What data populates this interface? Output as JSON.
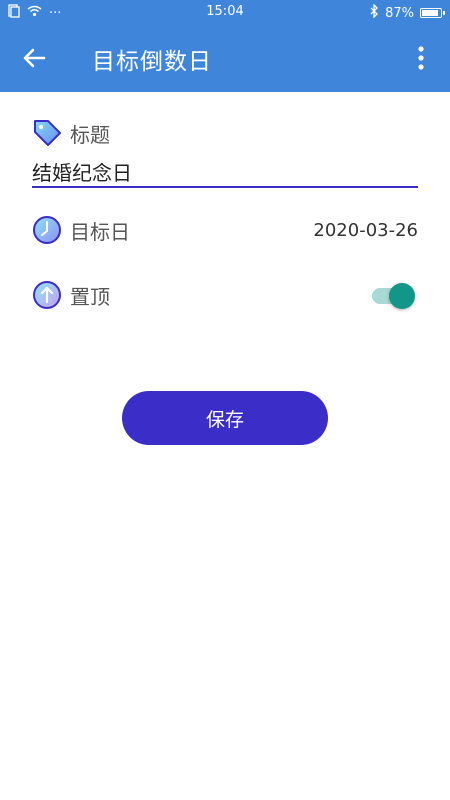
{
  "status_bar": {
    "time": "15:04",
    "battery_text": "87%",
    "more_dots": "···"
  },
  "app_bar": {
    "title": "目标倒数日"
  },
  "form": {
    "title_label": "标题",
    "title_value": "结婚纪念日",
    "target_date_label": "目标日",
    "target_date_value": "2020-03-26",
    "pin_label": "置顶",
    "pin_enabled": true
  },
  "actions": {
    "save_label": "保存"
  },
  "colors": {
    "app_bar": "#3f86da",
    "accent": "#3a2dc8",
    "toggle_on": "#119688"
  },
  "icons": {
    "back": "arrow-left-icon",
    "menu": "more-vert-icon",
    "title": "tag-icon",
    "date": "clock-icon",
    "pin": "arrow-up-circle-icon"
  }
}
